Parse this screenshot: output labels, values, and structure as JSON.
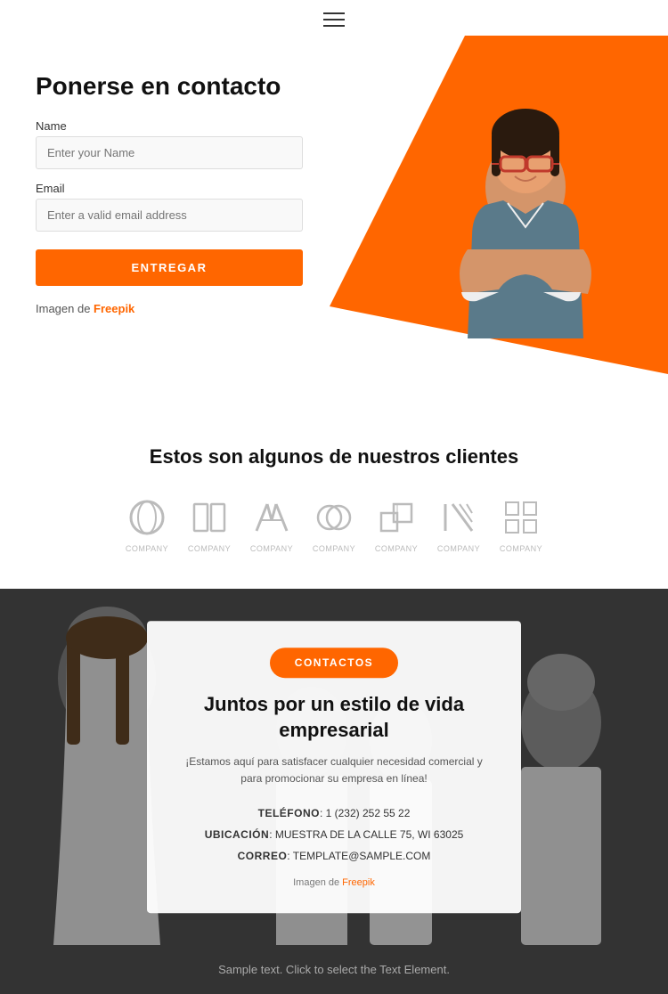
{
  "header": {
    "menu_icon": "hamburger-icon"
  },
  "hero": {
    "title": "Ponerse en contacto",
    "form": {
      "name_label": "Name",
      "name_placeholder": "Enter your Name",
      "email_label": "Email",
      "email_placeholder": "Enter a valid email address",
      "submit_label": "ENTREGAR"
    },
    "credit_text": "Imagen de ",
    "credit_link": "Freepik"
  },
  "clients": {
    "title": "Estos son algunos de nuestros clientes",
    "logos": [
      {
        "id": 1,
        "label": "COMPANY"
      },
      {
        "id": 2,
        "label": "COMPANY"
      },
      {
        "id": 3,
        "label": "COMPANY"
      },
      {
        "id": 4,
        "label": "COMPANY"
      },
      {
        "id": 5,
        "label": "COMPANY"
      },
      {
        "id": 6,
        "label": "COMPANY"
      },
      {
        "id": 7,
        "label": "COMPANY"
      }
    ]
  },
  "banner": {
    "button_label": "CONTACTOS",
    "title": "Juntos por un estilo de vida empresarial",
    "description": "¡Estamos aquí para satisfacer cualquier necesidad comercial y para promocionar su empresa en línea!",
    "phone_label": "TELÉFONO",
    "phone_value": ": 1 (232) 252 55 22",
    "location_label": "UBICACIÓN",
    "location_value": ": MUESTRA DE LA CALLE 75, WI 63025",
    "email_label": "CORREO",
    "email_value": ": TEMPLATE@SAMPLE.COM",
    "credit_text": "Imagen de ",
    "credit_link": "Freepik"
  },
  "footer": {
    "text": "Sample text. Click to select the Text Element."
  },
  "colors": {
    "accent": "#ff6600",
    "dark": "#333333"
  }
}
